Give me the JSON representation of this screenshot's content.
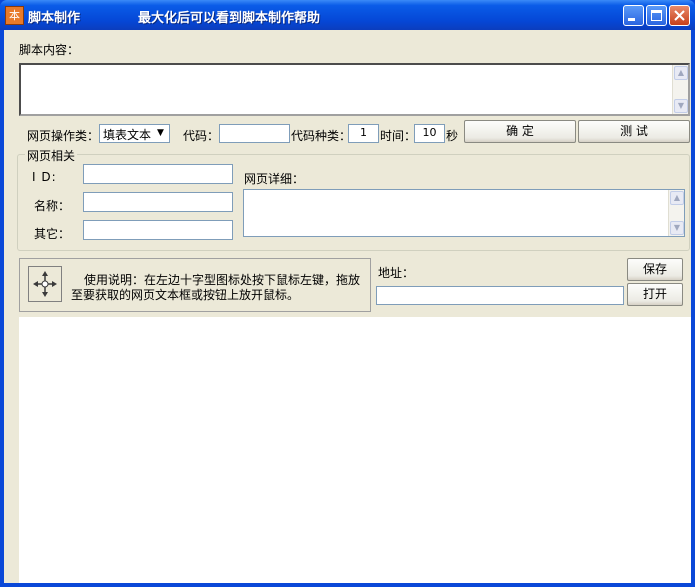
{
  "window": {
    "title": "脚本制作",
    "subtitle": "最大化后可以看到脚本制作帮助",
    "icon": "script-icon",
    "title_bar_color": "#0a48d8"
  },
  "script_content": {
    "label": "脚本内容：",
    "value": ""
  },
  "operation": {
    "type_label": "网页操作类：",
    "type_value": "填表文本",
    "code_label": "代码：",
    "code_value": "",
    "code_type_label": "代码种类：",
    "code_type_value": "1",
    "time_label": "时间：",
    "time_value": "10",
    "time_unit": "秒",
    "confirm_label": "确  定",
    "test_label": "测  试"
  },
  "web_group": {
    "title": "网页相关",
    "id_label": "I  D:",
    "id_value": "",
    "name_label": "名称：",
    "name_value": "",
    "other_label": "其它：",
    "other_value": "",
    "detail_label": "网页详细：",
    "detail_value": ""
  },
  "instructions": {
    "crosshair_icon": "crosshair-drag-icon",
    "line1": "使用说明：在左边十字型图标处按下鼠标左键，拖放",
    "line2": "至要获取的网页文本框或按钮上放开鼠标。"
  },
  "address": {
    "label": "地址：",
    "value": "",
    "save_label": "保存",
    "open_label": "打开"
  }
}
